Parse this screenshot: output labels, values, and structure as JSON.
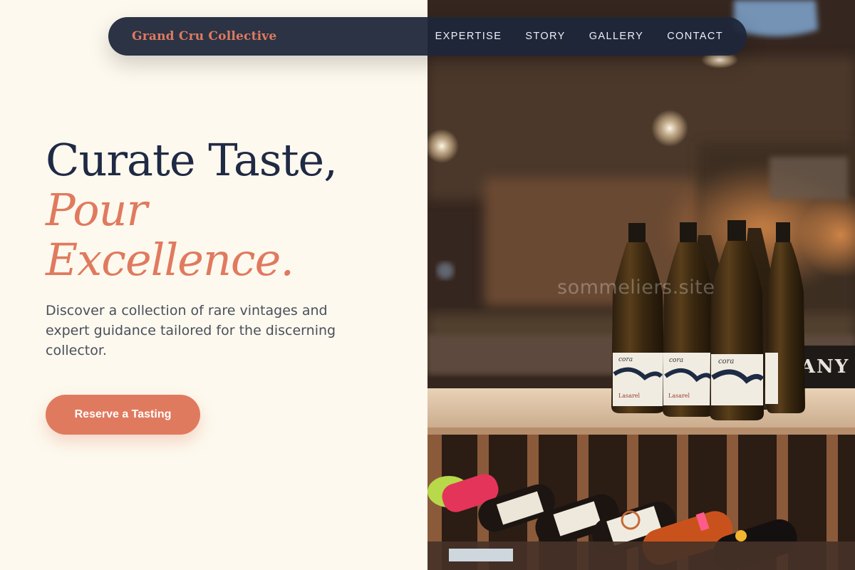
{
  "nav": {
    "brand": "Grand Cru Collective",
    "links": [
      "EXPERTISE",
      "STORY",
      "GALLERY",
      "CONTACT"
    ]
  },
  "hero": {
    "headline_line1": "Curate Taste,",
    "headline_line2": "Pour",
    "headline_line3": "Excellence.",
    "subtext": "Discover a collection of rare vintages and expert guidance tailored for the discerning collector.",
    "cta_label": "Reserve a Tasting"
  },
  "photo": {
    "watermark": "sommeliers.site",
    "sign_text": "MANY",
    "bottle_label_brand": "cora",
    "bottle_label_producer": "Lasarel"
  },
  "colors": {
    "background": "#fdf9ee",
    "navy": "#1f2a44",
    "accent": "#e07a5f"
  }
}
